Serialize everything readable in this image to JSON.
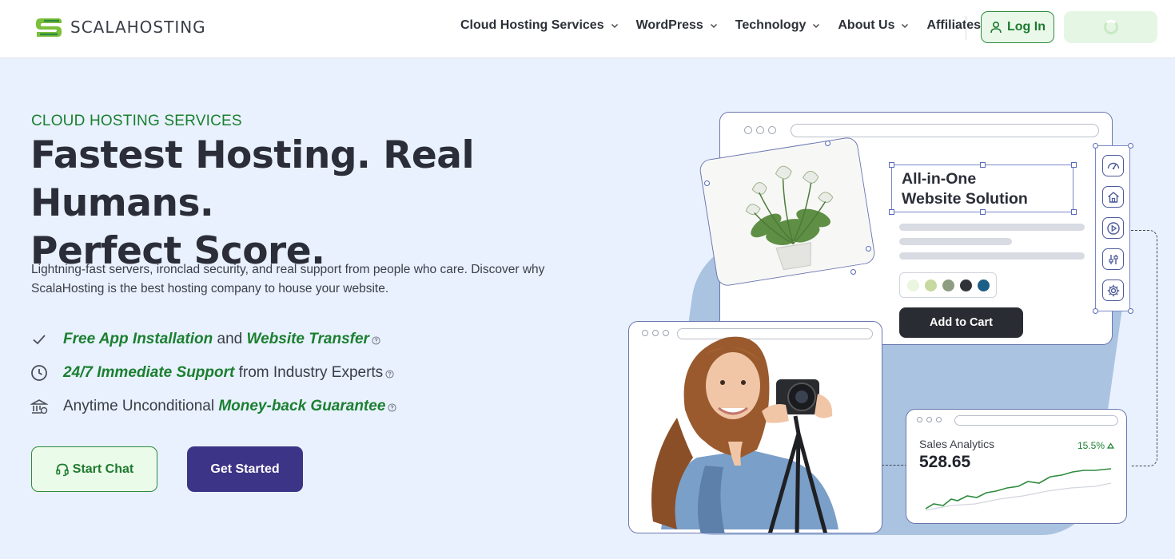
{
  "header": {
    "logo_text": "SCALAHOSTING",
    "nav": [
      {
        "label": "Cloud Hosting Services",
        "has_dropdown": true
      },
      {
        "label": "WordPress",
        "has_dropdown": true
      },
      {
        "label": "Technology",
        "has_dropdown": true
      },
      {
        "label": "About Us",
        "has_dropdown": true
      },
      {
        "label": "Affiliates",
        "has_dropdown": false
      }
    ],
    "login_label": "Log In",
    "login_icon": "user-icon",
    "signup_state": "loading"
  },
  "hero": {
    "eyebrow": "CLOUD HOSTING SERVICES",
    "headline_line1": "Fastest Hosting. Real Humans.",
    "headline_line2": "Perfect Score.",
    "lead": "Lightning-fast servers, ironclad security, and real support from people who care. Discover why ScalaHosting is the best hosting company to house your website.",
    "features": [
      {
        "icon": "check-icon",
        "parts": [
          {
            "text": "Free App Installation",
            "hl": true
          },
          {
            "text": " and ",
            "hl": false
          },
          {
            "text": "Website Transfer",
            "hl": true
          }
        ]
      },
      {
        "icon": "clock-icon",
        "parts": [
          {
            "text": "24/7 Immediate Support",
            "hl": true
          },
          {
            "text": " from Industry Experts",
            "hl": false
          }
        ]
      },
      {
        "icon": "bank-icon",
        "parts": [
          {
            "text": "Anytime Unconditional ",
            "hl": false
          },
          {
            "text": "Money-back Guarantee",
            "hl": true
          }
        ]
      }
    ],
    "chat_label": "Start Chat",
    "cta_label": "Get Started"
  },
  "illustration": {
    "aio_line1": "All-in-One",
    "aio_line2": "Website Solution",
    "add_to_cart": "Add to Cart",
    "swatch_colors": [
      "#eaf6df",
      "#c6d9a0",
      "#8e9c82",
      "#2f3238",
      "#1c5f86"
    ],
    "sales_title": "Sales Analytics",
    "sales_value": "528.65",
    "sales_change": "15.5%",
    "tool_icons": [
      "dashboard-icon",
      "home-icon",
      "play-icon",
      "sliders-icon",
      "settings-icon"
    ]
  },
  "colors": {
    "brand_green": "#1b7f30",
    "brand_purple": "#3c3486",
    "hero_bg": "#e8f1fd"
  }
}
